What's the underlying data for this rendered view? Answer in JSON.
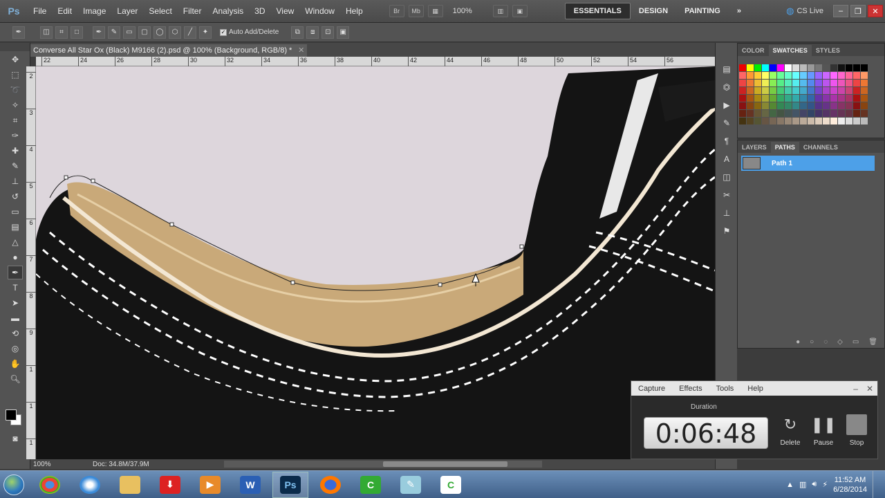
{
  "menubar": {
    "logo": "Ps",
    "items": [
      "File",
      "Edit",
      "Image",
      "Layer",
      "Select",
      "Filter",
      "Analysis",
      "3D",
      "View",
      "Window",
      "Help"
    ],
    "bridge": "Br",
    "minibridge": "Mb",
    "zoom": "100%",
    "workspaces": [
      "ESSENTIALS",
      "DESIGN",
      "PAINTING"
    ],
    "more": "»",
    "cslive": "CS Live",
    "colors": {
      "accent": "#4da0e8",
      "bg": "#535353"
    }
  },
  "options": {
    "auto_add_delete": "Auto Add/Delete",
    "auto_add_delete_checked": true
  },
  "document": {
    "tab_title": "Converse All Star Ox (Black) M9166 (2).psd @ 100% (Background, RGB/8) *",
    "ruler_h": [
      "22",
      "24",
      "26",
      "28",
      "30",
      "32",
      "34",
      "36",
      "38",
      "40",
      "42",
      "44",
      "46",
      "48",
      "50",
      "52",
      "54",
      "56"
    ],
    "ruler_v": [
      "2",
      "3",
      "4",
      "5",
      "6",
      "7",
      "8",
      "9",
      "1",
      "1",
      "1"
    ],
    "status_zoom": "100%",
    "status_doc": "Doc: 34.8M/37.9M"
  },
  "swatches": {
    "tabs": [
      "COLOR",
      "SWATCHES",
      "STYLES"
    ],
    "active": "SWATCHES"
  },
  "paths_panel": {
    "tabs": [
      "LAYERS",
      "PATHS",
      "CHANNELS"
    ],
    "active": "PATHS",
    "paths": [
      "Path 1"
    ]
  },
  "capture": {
    "menu": [
      "Capture",
      "Effects",
      "Tools",
      "Help"
    ],
    "duration_label": "Duration",
    "timer": "0:06:48",
    "buttons": [
      "Delete",
      "Pause",
      "Stop"
    ]
  },
  "taskbar": {
    "time": "11:52 AM",
    "date": "6/28/2014"
  }
}
